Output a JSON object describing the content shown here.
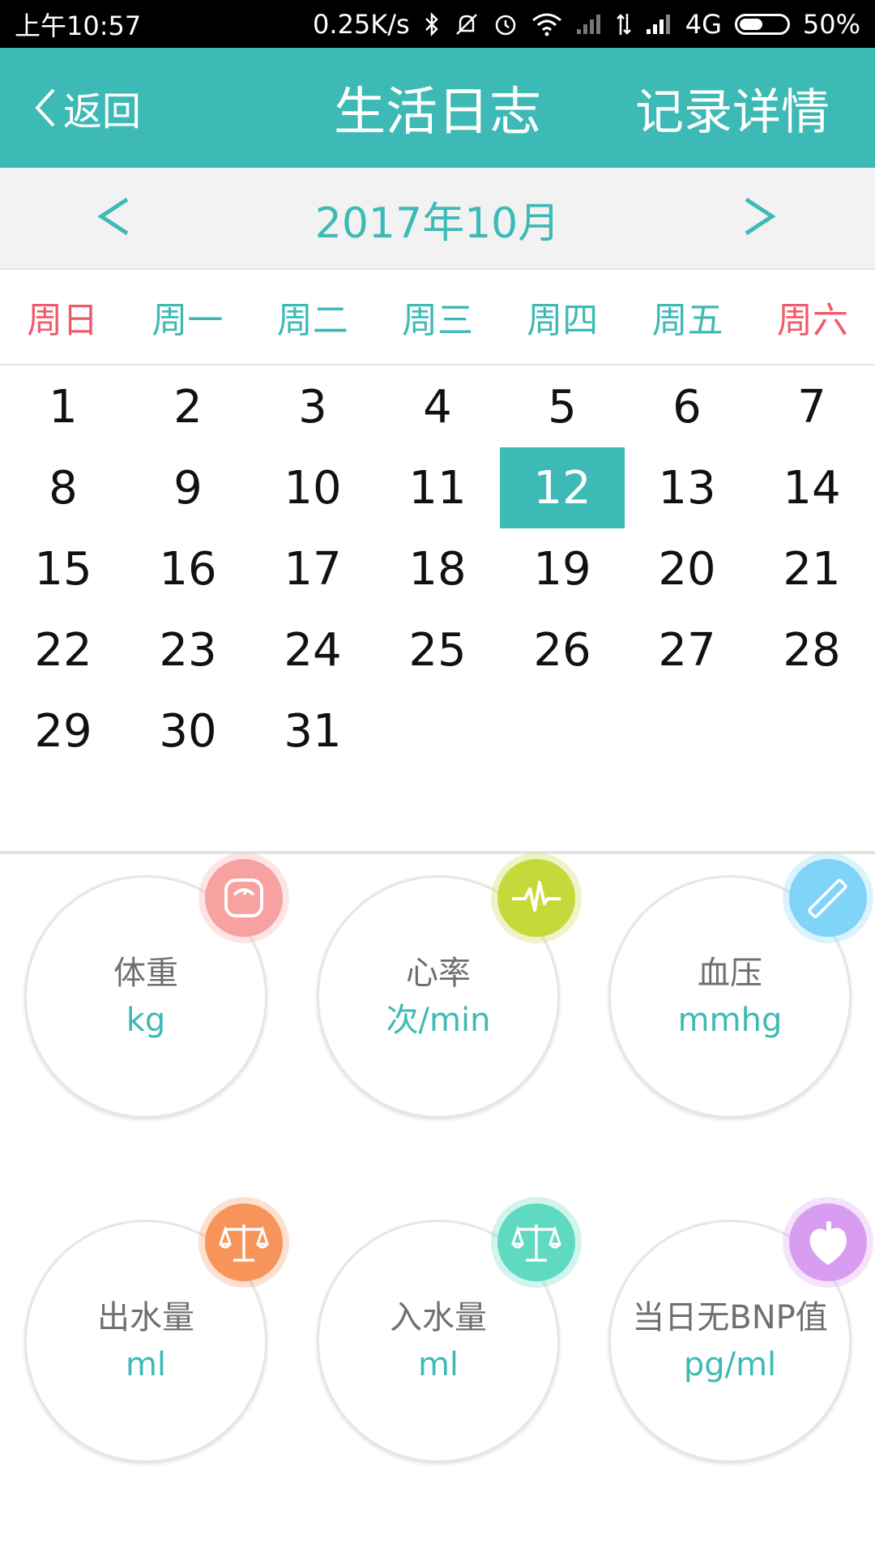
{
  "status_bar": {
    "time": "上午10:57",
    "net_speed": "0.25K/s",
    "network": "4G",
    "battery": "50%",
    "battery_level": 0.5
  },
  "header": {
    "back_label": "返回",
    "title": "生活日志",
    "detail_label": "记录详情"
  },
  "calendar": {
    "month_label": "2017年10月",
    "weekdays": [
      "周日",
      "周一",
      "周二",
      "周三",
      "周四",
      "周五",
      "周六"
    ],
    "days": [
      "1",
      "2",
      "3",
      "4",
      "5",
      "6",
      "7",
      "8",
      "9",
      "10",
      "11",
      "12",
      "13",
      "14",
      "15",
      "16",
      "17",
      "18",
      "19",
      "20",
      "21",
      "22",
      "23",
      "24",
      "25",
      "26",
      "27",
      "28",
      "29",
      "30",
      "31"
    ],
    "selected_day": "12"
  },
  "metrics": [
    {
      "name": "体重",
      "unit": "kg",
      "icon": "scale-icon",
      "color": "#f7a1a1"
    },
    {
      "name": "心率",
      "unit": "次/min",
      "icon": "heartbeat-icon",
      "color": "#c6d93a"
    },
    {
      "name": "血压",
      "unit": "mmhg",
      "icon": "pen-icon",
      "color": "#7fd4f7"
    },
    {
      "name": "出水量",
      "unit": "ml",
      "icon": "balance-icon",
      "color": "#f6945a"
    },
    {
      "name": "入水量",
      "unit": "ml",
      "icon": "balance-icon",
      "color": "#5fd9c0"
    },
    {
      "name": "当日无BNP值",
      "unit": "pg/ml",
      "icon": "heart-icon",
      "color": "#d89cf0"
    }
  ]
}
